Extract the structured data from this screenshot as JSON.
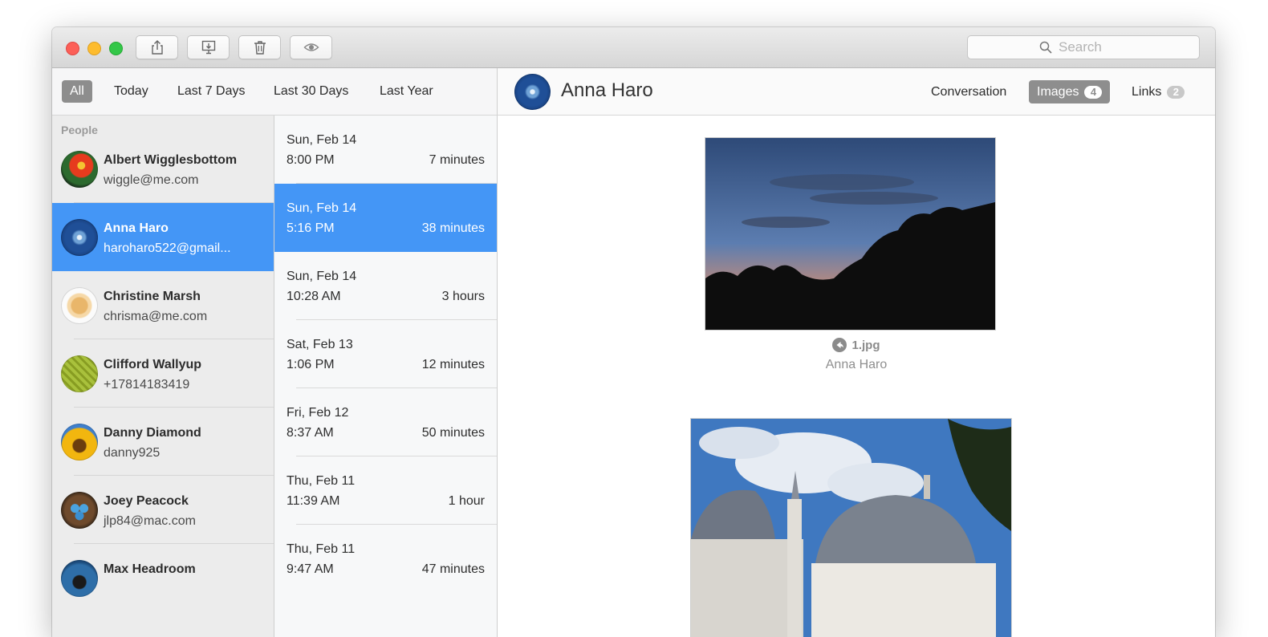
{
  "toolbar": {
    "buttons": [
      "share-icon",
      "export-icon",
      "trash-icon",
      "eye-icon"
    ],
    "search_placeholder": "Search"
  },
  "filters": [
    "All",
    "Today",
    "Last 7 Days",
    "Last 30 Days",
    "Last Year"
  ],
  "selected_filter": "All",
  "people": {
    "header": "People",
    "items": [
      {
        "name": "Albert Wigglesbottom",
        "contact": "wiggle@me.com",
        "avatar": "parrot-avatar"
      },
      {
        "name": "Anna Haro",
        "contact": "haroharo522@gmail...",
        "avatar": "snowflake-avatar",
        "selected": true
      },
      {
        "name": "Christine Marsh",
        "contact": "chrisma@me.com",
        "avatar": "fortune-cookie-avatar"
      },
      {
        "name": "Clifford Wallyup",
        "contact": "+17814183419",
        "avatar": "leaf-avatar"
      },
      {
        "name": "Danny Diamond",
        "contact": "danny925",
        "avatar": "sunflower-avatar"
      },
      {
        "name": "Joey Peacock",
        "contact": "jlp84@mac.com",
        "avatar": "eggs-avatar"
      },
      {
        "name": "Max Headroom",
        "contact": "",
        "avatar": "penguin-avatar"
      }
    ]
  },
  "sessions": [
    {
      "date": "Sun, Feb 14",
      "time": "8:00 PM",
      "duration": "7 minutes"
    },
    {
      "date": "Sun, Feb 14",
      "time": "5:16 PM",
      "duration": "38 minutes",
      "selected": true
    },
    {
      "date": "Sun, Feb 14",
      "time": "10:28 AM",
      "duration": "3 hours"
    },
    {
      "date": "Sat, Feb 13",
      "time": "1:06 PM",
      "duration": "12 minutes"
    },
    {
      "date": "Fri, Feb 12",
      "time": "8:37 AM",
      "duration": "50 minutes"
    },
    {
      "date": "Thu, Feb 11",
      "time": "11:39 AM",
      "duration": "1 hour"
    },
    {
      "date": "Thu, Feb 11",
      "time": "9:47 AM",
      "duration": "47 minutes"
    }
  ],
  "detail": {
    "name": "Anna Haro",
    "tabs": [
      {
        "label": "Conversation",
        "badge": null
      },
      {
        "label": "Images",
        "badge": "4",
        "active": true
      },
      {
        "label": "Links",
        "badge": "2"
      }
    ],
    "images": [
      {
        "filename": "1.jpg",
        "sender": "Anna Haro",
        "subject": "sunset-tree-silhouette"
      },
      {
        "filename": "",
        "sender": "",
        "subject": "mosque-domes"
      }
    ]
  },
  "colors": {
    "selection": "#4496f6",
    "active_pill": "#8d8d8d"
  }
}
